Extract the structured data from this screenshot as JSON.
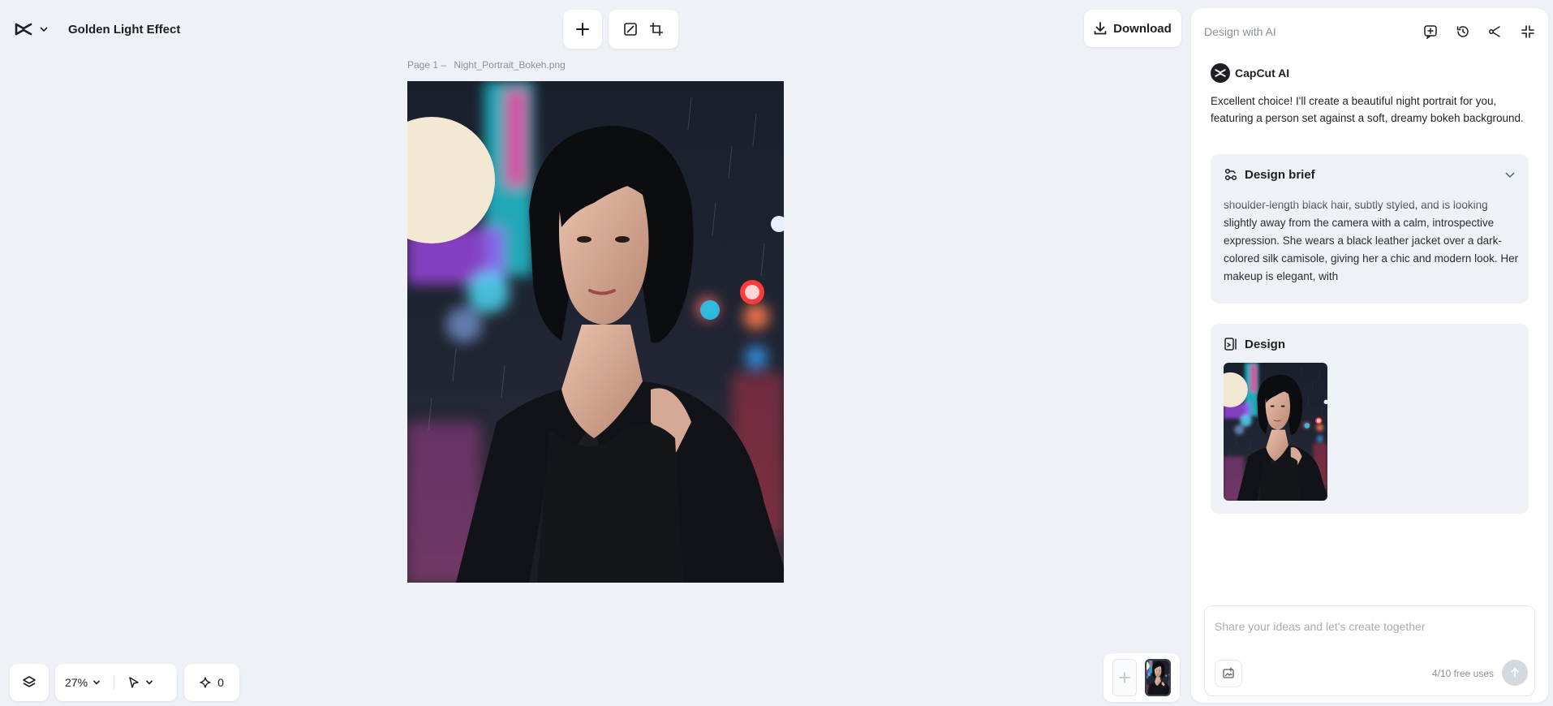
{
  "app": {
    "project_name": "Golden Light Effect"
  },
  "toolbar": {
    "download_label": "Download"
  },
  "canvas": {
    "page_label": "Page 1 –",
    "file_name": "Night_Portrait_Bokeh.png"
  },
  "bottom": {
    "zoom": "27%",
    "credits": "0"
  },
  "panel": {
    "title": "Design with AI",
    "author": "CapCut AI",
    "message": "Excellent choice! I'll create a beautiful night portrait for you, featuring a person set against a soft, dreamy bokeh background.",
    "brief": {
      "title": "Design brief",
      "text": "shoulder-length black hair, subtly styled, and is looking slightly away from the camera with a calm, introspective expression. She wears a black leather jacket over a dark-colored silk camisole, giving her a chic and modern look. Her makeup is elegant, with"
    },
    "design": {
      "title": "Design"
    },
    "composer": {
      "placeholder": "Share your ideas and let's create together",
      "free_uses": "4/10 free uses"
    }
  },
  "colors": {
    "background": "#eef2f6",
    "panel": "#ffffff",
    "text": "#1d1f24",
    "muted": "#8a9099"
  },
  "icons": {
    "logo": "capcut-logo-icon",
    "add": "plus-icon",
    "edit": "edit-image-icon",
    "resize": "resize-icon",
    "download": "download-icon",
    "layers": "layers-icon",
    "pointer": "pointer-icon",
    "sparkle": "sparkle-icon",
    "new_chat": "new-chat-icon",
    "history": "history-icon",
    "share": "share-icon",
    "collapse": "collapse-icon",
    "brief": "brief-icon",
    "design": "design-icon",
    "attach": "attach-image-icon",
    "send": "send-icon"
  }
}
